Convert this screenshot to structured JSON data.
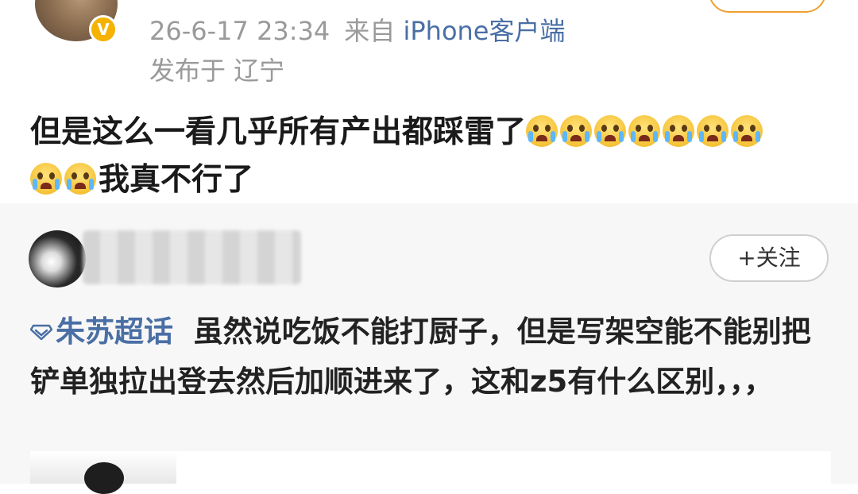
{
  "post": {
    "timestamp": "26-6-17 23:34",
    "source_prefix": "来自",
    "source_client": "iPhone客户端",
    "location": "发布于 辽宁",
    "verified_badge": "V",
    "text": "但是这么一看几乎所有产出都踩雷了",
    "text_line2": "我真不行了",
    "emoji_name": "crying-face-icon",
    "emoji_count_line1": 7,
    "emoji_count_line2": 2
  },
  "repost": {
    "follow_label": "+关注",
    "topic_label": "朱苏超话",
    "text": "虽然说吃饭不能打厨子，但是写架空能不能别把铲单独拉出登去然后加顺进来了，这和z5有什么区别，，，"
  },
  "colors": {
    "link_blue": "#4a6fa5",
    "meta_gray": "#9a9a9a",
    "badge_gold": "#f5b300",
    "follow_orange": "#f0a030"
  }
}
